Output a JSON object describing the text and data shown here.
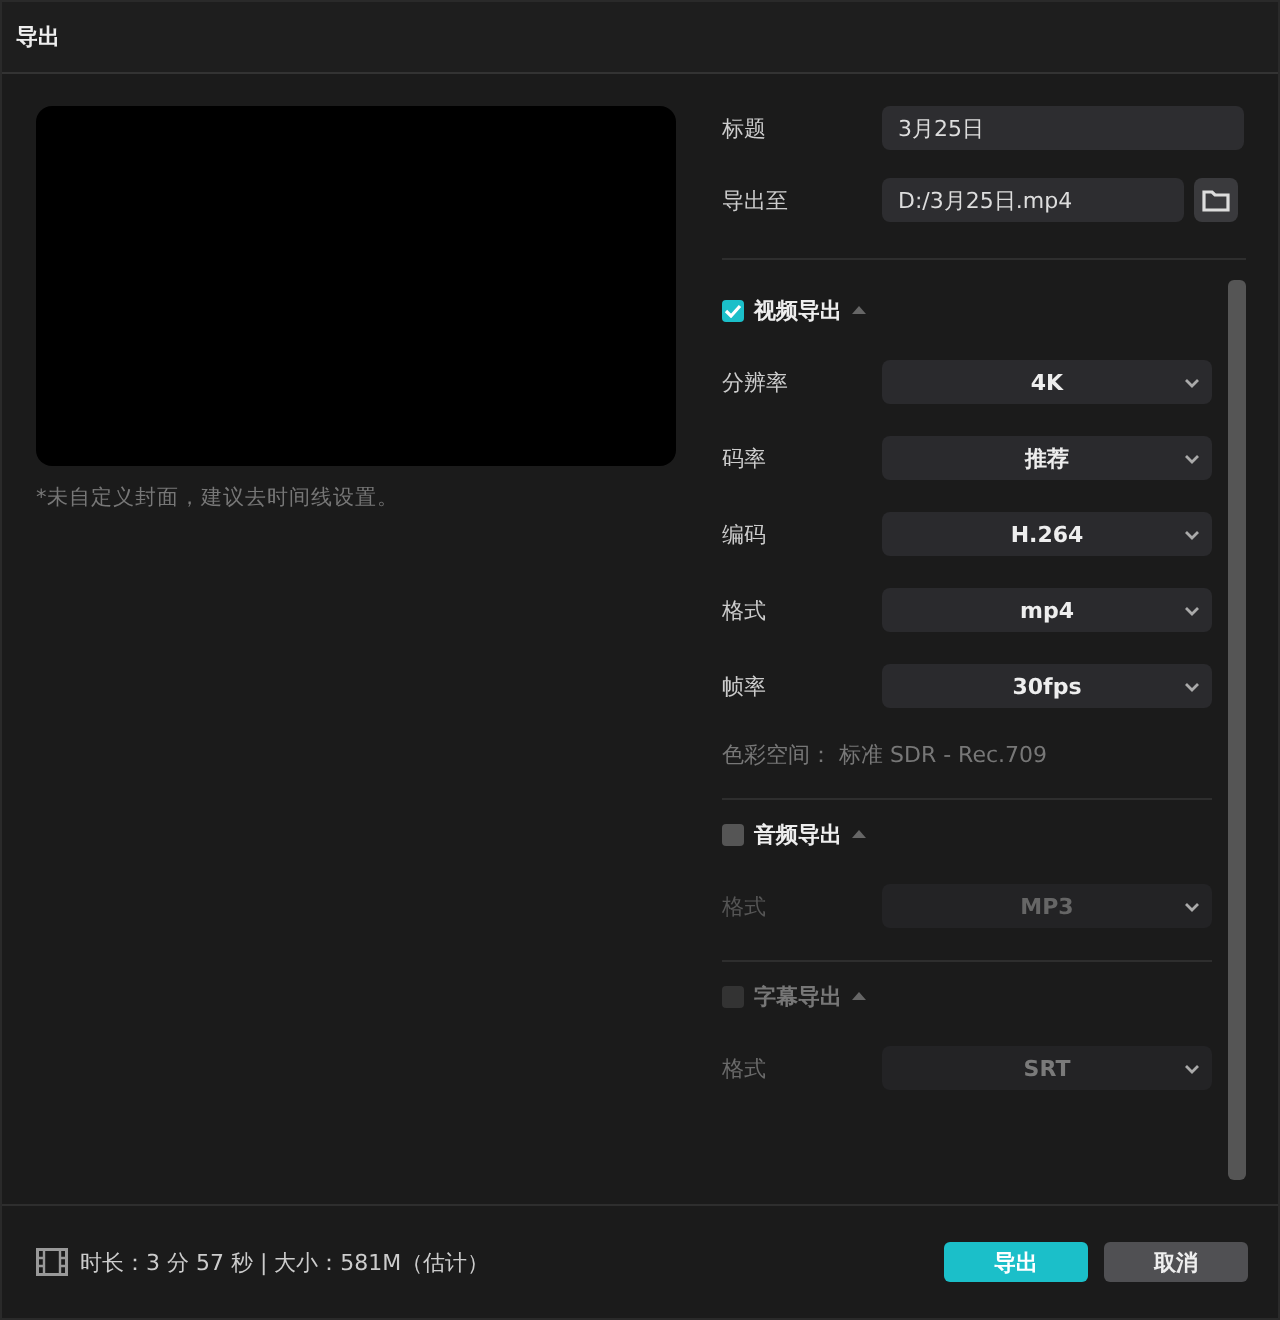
{
  "window": {
    "title": "导出"
  },
  "preview": {
    "note": "*未自定义封面，建议去时间线设置。"
  },
  "title_field": {
    "label": "标题",
    "value": "3月25日"
  },
  "export_to": {
    "label": "导出至",
    "value": "D:/3月25日.mp4"
  },
  "sections": [
    {
      "title": "视频导出",
      "checked": true,
      "disabled": false,
      "fields": [
        {
          "label": "分辨率",
          "value": "4K"
        },
        {
          "label": "码率",
          "value": "推荐"
        },
        {
          "label": "编码",
          "value": "H.264"
        },
        {
          "label": "格式",
          "value": "mp4"
        },
        {
          "label": "帧率",
          "value": "30fps"
        }
      ],
      "note": "色彩空间： 标准 SDR - Rec.709"
    },
    {
      "title": "音频导出",
      "checked": false,
      "disabled": false,
      "fields": [
        {
          "label": "格式",
          "value": "MP3"
        }
      ]
    },
    {
      "title": "字幕导出",
      "checked": false,
      "disabled": true,
      "fields": [
        {
          "label": "格式",
          "value": "SRT"
        }
      ]
    }
  ],
  "footer": {
    "info": "时长：3 分 57 秒 | 大小：581M（估计）",
    "buttons": [
      {
        "label": "导出",
        "kind": "primary"
      },
      {
        "label": "取消",
        "kind": "secondary"
      }
    ]
  }
}
